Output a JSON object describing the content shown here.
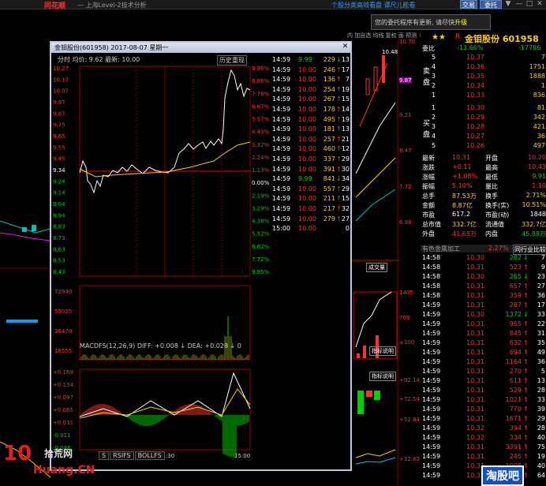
{
  "topbar": {
    "brand": "同花顺",
    "title": "— 上海Level-2技术分析",
    "news": "个股分类高效看盘   谭尺儿能看",
    "trade": "交易",
    "acct": "委托",
    "win": [
      "▼",
      "—",
      "□",
      "✕"
    ]
  },
  "notice": {
    "text": "您的委托程序有更新, 请尽快",
    "upgrade": "升级"
  },
  "minibar": "内 加自选 均线 复权 画 预测 ↕",
  "popup": {
    "title": "金钼股份(601958) 2017-08-07 星期一",
    "close": "✕",
    "info": "分时  均价: 9.62  最新: 10.00",
    "hist": "历史重现",
    "left_axis": [
      "10.27",
      "10.17",
      "10.07",
      "9.97",
      "9.87",
      "9.75",
      "9.65",
      "9.55",
      "9.45",
      "9.34",
      "9.24",
      "9.14",
      "9.04",
      "8.94",
      "8.83",
      "8.73",
      "8.63",
      "8.53",
      "8.43"
    ],
    "pct_axis": [
      "9.96%",
      "8.86%",
      "7.76%",
      "6.67%",
      "5.57%",
      "4.43%",
      "3.32%",
      "2.24%",
      "1.13%",
      "0.00%",
      "2.19%",
      "3.29%",
      "4.38%",
      "5.52%",
      "6.62%",
      "7.72%",
      "9.95%"
    ],
    "vol_axis": [
      "72940",
      "55025",
      "36470",
      "18555"
    ],
    "macd_axis": [
      "+0.169",
      "+0.134",
      "+0.097",
      "+0.065",
      "+0.031",
      "-0.011",
      "-0.046"
    ],
    "time_axis": [
      "11:30",
      "15:00"
    ],
    "macd_label": "MACDFS(12,26,9)  DIFF: +0.008 ↓  DEA: +0.028 ↓  0",
    "tabs": [
      "S",
      "RSIFS",
      "BOLLFS"
    ],
    "ticks": [
      {
        "t": "14:59",
        "p": "9.99",
        "v": "229",
        "d": "↓",
        "c": "13"
      },
      {
        "t": "14:59",
        "p": "10.00",
        "v": "246",
        "d": "↑",
        "c": "17"
      },
      {
        "t": "14:59",
        "p": "10.00",
        "v": "136",
        "d": "↑",
        "c": "7"
      },
      {
        "t": "14:59",
        "p": "10.00",
        "v": "254",
        "d": "↑",
        "c": "19"
      },
      {
        "t": "14:59",
        "p": "10.00",
        "v": "267",
        "d": "↑",
        "c": "15"
      },
      {
        "t": "14:59",
        "p": "10.00",
        "v": "178",
        "d": "↑",
        "c": "14"
      },
      {
        "t": "14:59",
        "p": "10.00",
        "v": "495",
        "d": "↑",
        "c": "19"
      },
      {
        "t": "14:59",
        "p": "10.00",
        "v": "181",
        "d": "↑",
        "c": "13"
      },
      {
        "t": "14:59",
        "p": "10.00",
        "v": "257",
        "d": "↑",
        "c": "21"
      },
      {
        "t": "14:59",
        "p": "10.00",
        "v": "460",
        "d": "↑",
        "c": "12"
      },
      {
        "t": "14:59",
        "p": "10.00",
        "v": "337",
        "d": "↑",
        "c": "29"
      },
      {
        "t": "14:59",
        "p": "10.00",
        "v": "391",
        "d": "↑",
        "c": "30"
      },
      {
        "t": "14:59",
        "p": "9.99",
        "v": "841",
        "d": "↓",
        "c": "34"
      },
      {
        "t": "14:59",
        "p": "10.00",
        "v": "557",
        "d": "↑",
        "c": "29"
      },
      {
        "t": "14:59",
        "p": "10.00",
        "v": "211",
        "d": "↑",
        "c": "15"
      },
      {
        "t": "14:59",
        "p": "10.00",
        "v": "217",
        "d": "↑",
        "c": "32"
      },
      {
        "t": "14:59",
        "p": "10.00",
        "v": "279",
        "d": "↑",
        "c": "27"
      },
      {
        "t": "15:00",
        "p": "10.00",
        "v": "",
        "d": "",
        "c": "0"
      }
    ]
  },
  "mid": {
    "p1": "10.70",
    "p2": "10.48",
    "p3": "9.87",
    "p4": "9.21",
    "p5": "8.47",
    "p6": "7.72",
    "p7": "6.98",
    "box": "成交量",
    "v1": "1405",
    "v2": "709",
    "v3": "±100",
    "btn1": "指标说明",
    "btn2": "指标说明",
    "m1": "+92.14",
    "m2": "+72.54",
    "m3": "+52.94",
    "m4": "+32.83"
  },
  "rp": {
    "title": "金钼股份 601958",
    "r_label": "R",
    "weibi": {
      "k": "委比",
      "a": "-13.66%",
      "b": "-17786"
    },
    "sells": [
      {
        "n": "5",
        "p": "10.37",
        "v": "7"
      },
      {
        "n": "4",
        "p": "10.36",
        "v": "1751"
      },
      {
        "n": "3",
        "p": "10.35",
        "v": "1888"
      },
      {
        "n": "2",
        "p": "10.34",
        "v": "1"
      },
      {
        "n": "1",
        "p": "10.33",
        "v": "836"
      }
    ],
    "sell_label": "卖盘",
    "buys": [
      {
        "n": "1",
        "p": "10.30",
        "v": "81"
      },
      {
        "n": "2",
        "p": "10.29",
        "v": "342"
      },
      {
        "n": "3",
        "p": "10.28",
        "v": "421"
      },
      {
        "n": "4",
        "p": "10.27",
        "v": "36"
      },
      {
        "n": "5",
        "p": "10.26",
        "v": "497"
      }
    ],
    "buy_label": "买盘",
    "stats": [
      [
        "最新",
        "10.31",
        "开盘",
        "10.20"
      ],
      [
        "涨跌",
        "+0.11",
        "最高",
        "10.43"
      ],
      [
        "涨幅",
        "+1.08%",
        "最低",
        "9.91"
      ],
      [
        "振幅",
        "5.10%",
        "量比",
        "1.10"
      ],
      [
        "总手",
        "87.53万",
        "换手",
        "2.71%"
      ],
      [
        "金额",
        "8.87亿",
        "换手(实)",
        "10.51%"
      ],
      [
        "市盈",
        "617.2",
        "市盈(动)",
        "1848"
      ],
      [
        "总市值",
        "332.7亿",
        "流通值",
        "332.7亿"
      ],
      [
        "外盘",
        "41.65万",
        "内盘",
        "45.88万"
      ]
    ],
    "sector": {
      "name": "有色金属加工",
      "chg": "2.27%",
      "btn": "同行业比较"
    },
    "trades": [
      [
        "14:58",
        "10.30",
        "282",
        "↓",
        "7"
      ],
      [
        "14:58",
        "10.31",
        "523",
        "↑",
        "9"
      ],
      [
        "14:58",
        "10.30",
        "265",
        "↓",
        "23"
      ],
      [
        "14:58",
        "10.31",
        "657",
        "↑",
        "27"
      ],
      [
        "14:58",
        "10.31",
        "359",
        "↑",
        "36"
      ],
      [
        "14:59",
        "10.31",
        "287",
        "↑",
        "17"
      ],
      [
        "14:59",
        "10.30",
        "1372",
        "↓",
        "33"
      ],
      [
        "14:59",
        "10.31",
        "955",
        "↑",
        "22"
      ],
      [
        "14:59",
        "10.31",
        "845",
        "↑",
        "31"
      ],
      [
        "14:59",
        "10.31",
        "632",
        "↑",
        "35"
      ],
      [
        "14:59",
        "10.31",
        "694",
        "↑",
        "49"
      ],
      [
        "14:59",
        "10.31",
        "1164",
        "↑",
        "36"
      ],
      [
        "14:59",
        "10.31",
        "270",
        "↑",
        "5"
      ],
      [
        "14:59",
        "10.31",
        "611",
        "↑",
        "13"
      ],
      [
        "14:59",
        "10.31",
        "529",
        "↑",
        "28"
      ],
      [
        "14:59",
        "10.31",
        "1021",
        "↑",
        "33"
      ],
      [
        "14:59",
        "10.31",
        "770",
        "↑",
        "39"
      ],
      [
        "14:59",
        "10.31",
        "1671",
        "↑",
        "29"
      ],
      [
        "14:59",
        "10.32",
        "394",
        "↑",
        "28"
      ],
      [
        "14:59",
        "10.32",
        "334",
        "↑",
        "40"
      ],
      [
        "14:59",
        "10.31",
        "3391",
        "↑",
        "75"
      ],
      [
        "14:59",
        "10.31",
        "245",
        "↑",
        "19"
      ],
      [
        "14:59",
        "10.31",
        "1008",
        "↑",
        "40"
      ],
      [
        "14:59",
        "10.31",
        "1064",
        "↑",
        "64"
      ]
    ]
  },
  "watermark": {
    "a": "10",
    "b": "拾荒网",
    "c": "Huang.CN",
    "d": "淘股吧"
  },
  "colors": {
    "up": "#ff3030",
    "down": "#00d000",
    "price": "#ffffff",
    "avg": "#ffd000",
    "frame": "#c00000"
  }
}
